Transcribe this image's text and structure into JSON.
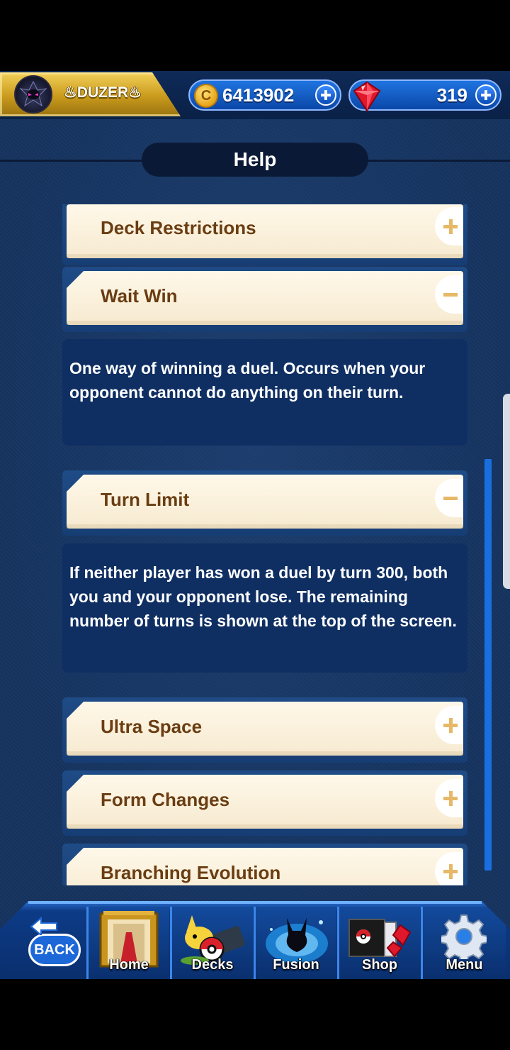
{
  "player": {
    "name": "♨DUZER♨",
    "avatar": "dark-pokemon-avatar"
  },
  "currency": {
    "coins": {
      "icon": "coin-icon",
      "symbol": "C",
      "value": "6413902"
    },
    "gems": {
      "icon": "ruby-gem-icon",
      "value": "319"
    }
  },
  "page": {
    "title": "Help"
  },
  "help_items": [
    {
      "label": "Deck Restrictions",
      "expanded": false,
      "toggle_icon": "plus-icon"
    },
    {
      "label": "Wait Win",
      "expanded": true,
      "toggle_icon": "minus-icon",
      "description": "One way of winning a duel. Occurs when your opponent cannot do anything on their turn."
    },
    {
      "label": "Turn Limit",
      "expanded": true,
      "toggle_icon": "minus-icon",
      "description": "If neither player has won a duel by turn 300, both you and your opponent lose. The remaining number of turns is shown at the top of the screen."
    },
    {
      "label": "Ultra Space",
      "expanded": false,
      "toggle_icon": "plus-icon"
    },
    {
      "label": "Form Changes",
      "expanded": false,
      "toggle_icon": "plus-icon"
    },
    {
      "label": "Branching Evolution",
      "expanded": false,
      "toggle_icon": "plus-icon"
    }
  ],
  "nav": {
    "back": "BACK",
    "items": [
      {
        "label": "Home",
        "icon": "home-hall-icon"
      },
      {
        "label": "Decks",
        "icon": "decks-pikachu-icon"
      },
      {
        "label": "Fusion",
        "icon": "fusion-silhouette-icon"
      },
      {
        "label": "Shop",
        "icon": "shop-box-icon"
      },
      {
        "label": "Menu",
        "icon": "gear-icon"
      }
    ]
  },
  "colors": {
    "background": "#15335f",
    "item_label": "#6a3d12",
    "toggle_icon": "#e6b867",
    "description_bg": "#0f2f63",
    "accent_blue": "#1a6fe0",
    "gold": "#d8a82a"
  }
}
